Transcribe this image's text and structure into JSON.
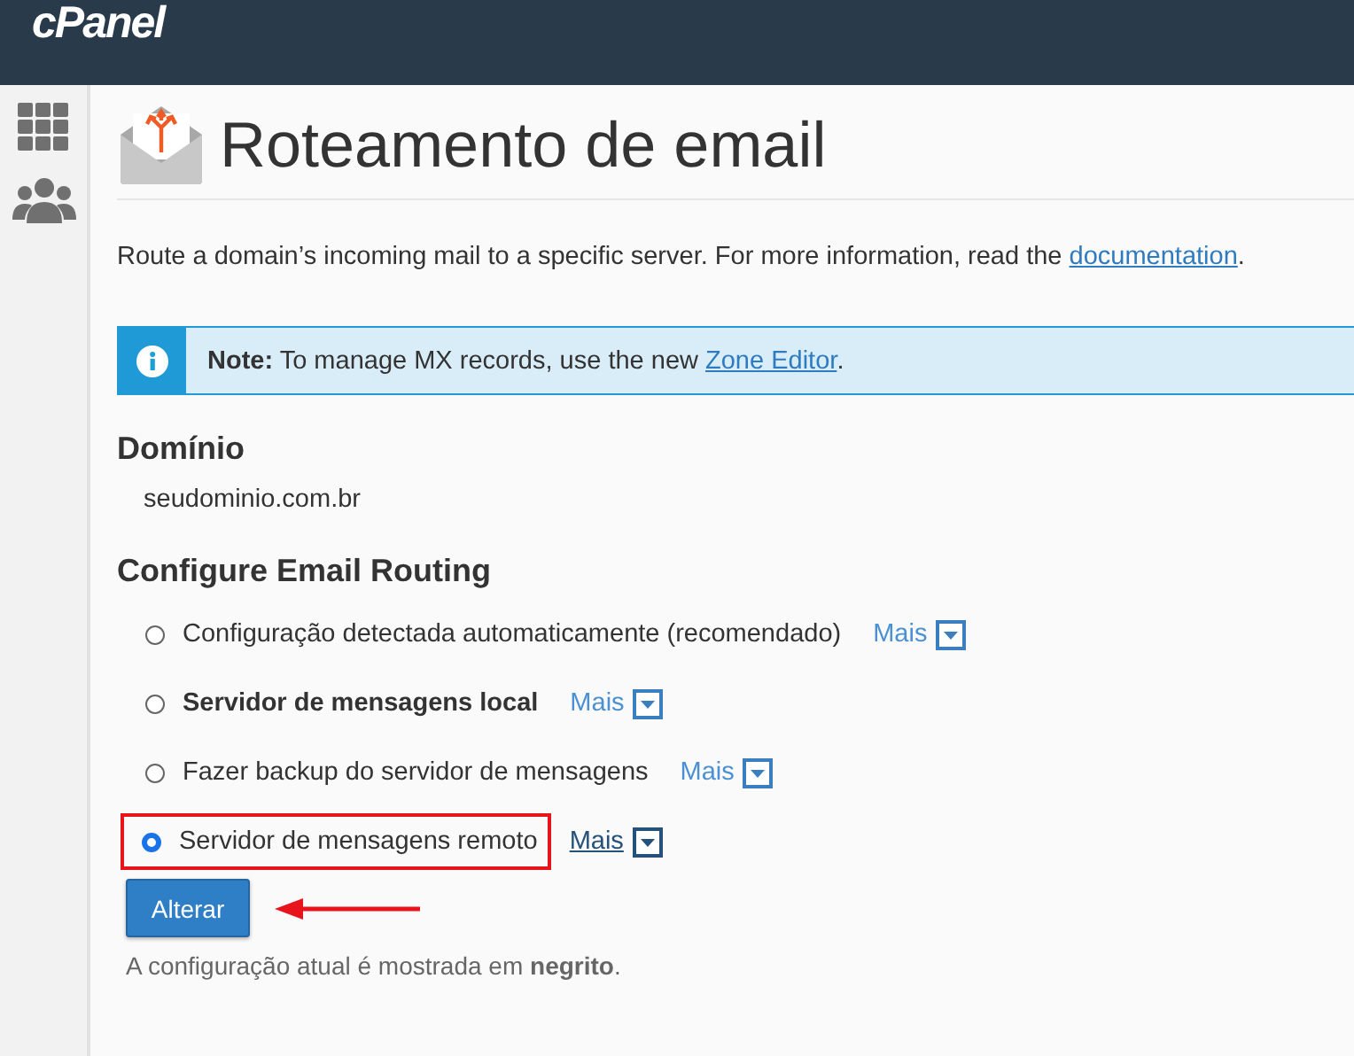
{
  "header": {
    "logo": "cPanel"
  },
  "page": {
    "title": "Roteamento de email",
    "description": "Route a domain’s incoming mail to a specific server. For more information, read the",
    "description_link": "documentation",
    "description_end": "."
  },
  "note": {
    "text": "**Note:** To manage MX records, use the new",
    "link": "Zone Editor",
    "end": "."
  },
  "domain": {
    "heading": "Domínio",
    "value": "seudominio.com.br"
  },
  "routing": {
    "heading": "Configure Email Routing",
    "options": [
      {
        "label": "Configuração detectada automaticamente (recomendado)",
        "selected": false,
        "current": false,
        "highlighted": false,
        "more": "Mais",
        "more_hovered": false
      },
      {
        "label": "Servidor de mensagens local",
        "selected": false,
        "current": true,
        "highlighted": false,
        "more": "Mais",
        "more_hovered": false
      },
      {
        "label": "Fazer backup do servidor de mensagens",
        "selected": false,
        "current": false,
        "highlighted": false,
        "more": "Mais",
        "more_hovered": false
      },
      {
        "label": "Servidor de mensagens remoto",
        "selected": true,
        "current": false,
        "highlighted": true,
        "more": "Mais",
        "more_hovered": true
      }
    ],
    "button": "Alterar",
    "footnote": "A configuração atual é mostrada em **negrito**."
  }
}
